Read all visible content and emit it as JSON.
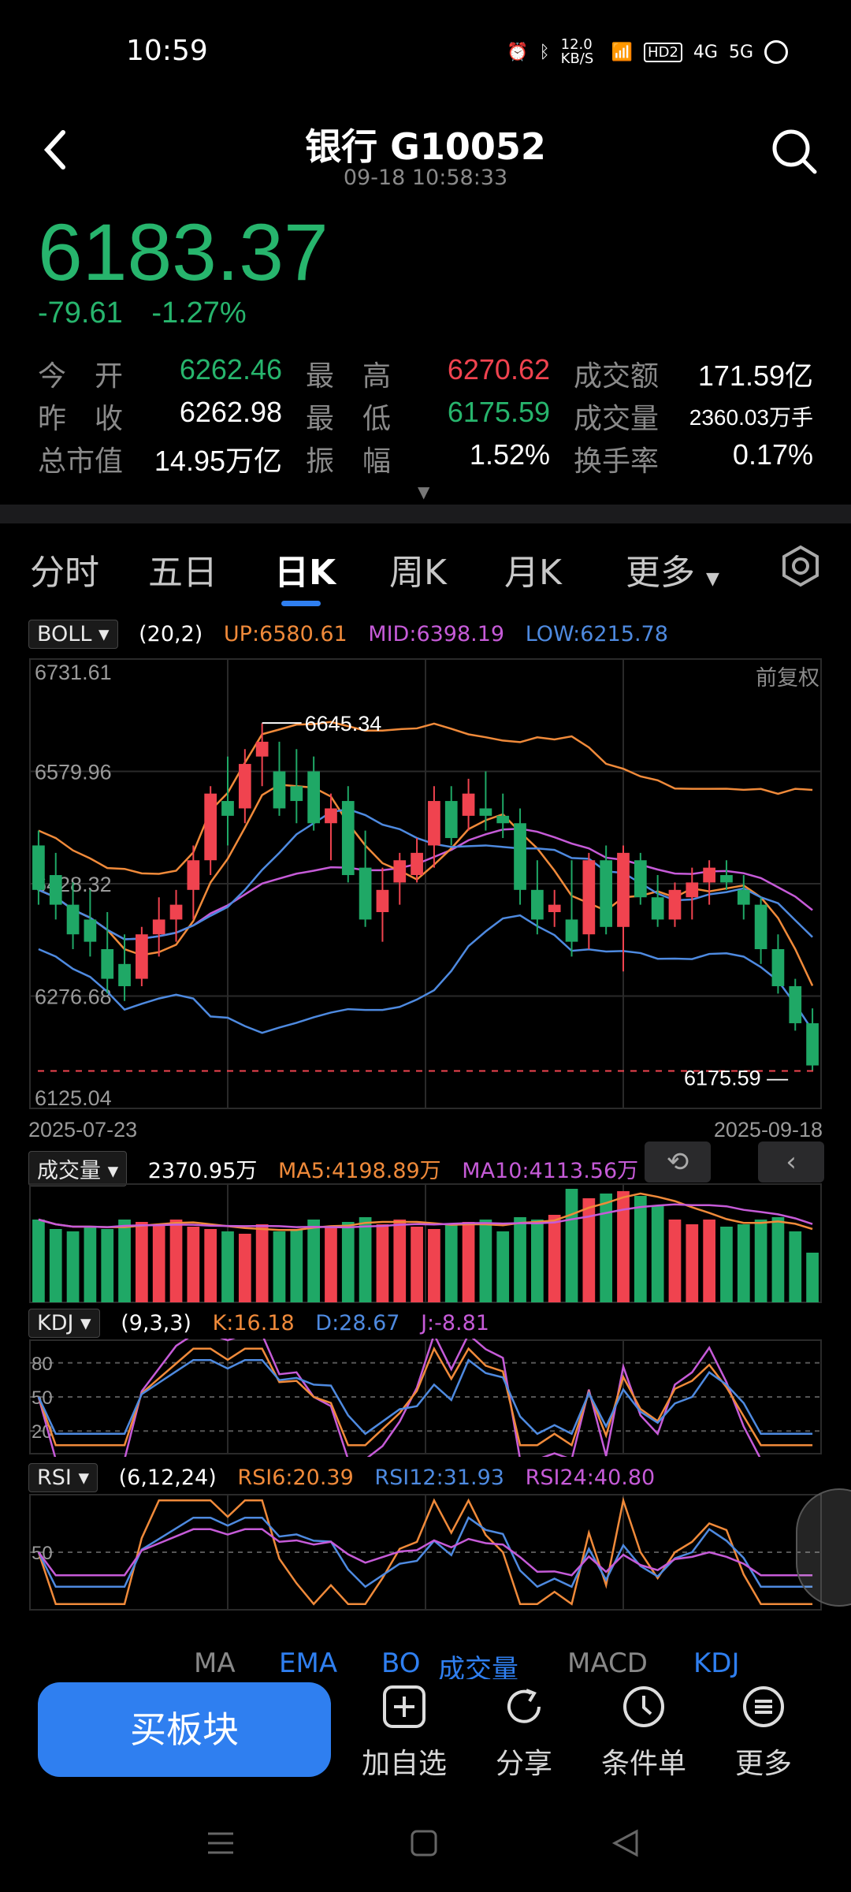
{
  "status": {
    "time": "10:59",
    "net_speed": "12.0 KB/S",
    "hd": "HD2",
    "sig1": "4G",
    "sig2": "5G"
  },
  "header": {
    "title": "银行 G10052",
    "timestamp": "09-18 10:58:33"
  },
  "quote": {
    "price": "6183.37",
    "change": "-79.61",
    "change_pct": "-1.27%"
  },
  "stats": {
    "open_label": "今　开",
    "open": "6262.46",
    "high_label": "最　高",
    "high": "6270.62",
    "turnover_label": "成交额",
    "turnover": "171.59亿",
    "prev_label": "昨　收",
    "prev": "6262.98",
    "low_label": "最　低",
    "low": "6175.59",
    "volume_label": "成交量",
    "volume": "2360.03万手",
    "mktcap_label": "总市值",
    "mktcap": "14.95万亿",
    "amp_label": "振　幅",
    "amp": "1.52%",
    "turnrate_label": "换手率",
    "turnrate": "0.17%"
  },
  "tabs": [
    "分时",
    "五日",
    "日K",
    "周K",
    "月K",
    "更多"
  ],
  "boll": {
    "name": "BOLL",
    "params": "(20,2)",
    "up": "UP:6580.61",
    "mid": "MID:6398.19",
    "low": "LOW:6215.78",
    "fq": "前复权"
  },
  "vol": {
    "name": "成交量",
    "value": "2370.95万",
    "ma5": "MA5:4198.89万",
    "ma10": "MA10:4113.56万"
  },
  "kdj": {
    "name": "KDJ",
    "params": "(9,3,3)",
    "k": "K:16.18",
    "d": "D:28.67",
    "j": "J:-8.81"
  },
  "rsi": {
    "name": "RSI",
    "params": "(6,12,24)",
    "rsi6": "RSI6:20.39",
    "rsi12": "RSI12:31.93",
    "rsi24": "RSI24:40.80"
  },
  "dates": {
    "start": "2025-07-23",
    "end": "2025-09-18"
  },
  "bottom_tabs": [
    "MA",
    "EMA",
    "BO",
    "成交量",
    "MACD",
    "KDJ"
  ],
  "actions": {
    "buy": "买板块",
    "watch": "加自选",
    "share": "分享",
    "condition": "条件单",
    "more": "更多"
  },
  "chart_data": {
    "type": "candlestick",
    "y_ticks": [
      "6731.61",
      "6579.96",
      "6428.32",
      "6276.68",
      "6125.04"
    ],
    "ylim": [
      6125.04,
      6731.61
    ],
    "annotations": {
      "max": "6645.34",
      "min": "6175.59"
    },
    "candles": [
      [
        6480,
        6500,
        6400,
        6420
      ],
      [
        6440,
        6470,
        6380,
        6400
      ],
      [
        6400,
        6430,
        6340,
        6360
      ],
      [
        6380,
        6420,
        6330,
        6350
      ],
      [
        6340,
        6390,
        6280,
        6300
      ],
      [
        6320,
        6360,
        6270,
        6290
      ],
      [
        6300,
        6370,
        6290,
        6360
      ],
      [
        6360,
        6410,
        6330,
        6380
      ],
      [
        6380,
        6420,
        6350,
        6400
      ],
      [
        6420,
        6480,
        6380,
        6460
      ],
      [
        6460,
        6560,
        6440,
        6550
      ],
      [
        6540,
        6600,
        6480,
        6520
      ],
      [
        6530,
        6610,
        6510,
        6590
      ],
      [
        6600,
        6645,
        6560,
        6620
      ],
      [
        6580,
        6620,
        6520,
        6530
      ],
      [
        6560,
        6610,
        6510,
        6540
      ],
      [
        6580,
        6600,
        6500,
        6510
      ],
      [
        6510,
        6550,
        6460,
        6530
      ],
      [
        6540,
        6560,
        6430,
        6440
      ],
      [
        6450,
        6500,
        6370,
        6380
      ],
      [
        6390,
        6450,
        6350,
        6420
      ],
      [
        6430,
        6470,
        6400,
        6460
      ],
      [
        6440,
        6490,
        6430,
        6470
      ],
      [
        6480,
        6560,
        6450,
        6540
      ],
      [
        6540,
        6560,
        6480,
        6490
      ],
      [
        6520,
        6570,
        6500,
        6550
      ],
      [
        6530,
        6580,
        6500,
        6520
      ],
      [
        6520,
        6550,
        6490,
        6510
      ],
      [
        6510,
        6530,
        6400,
        6420
      ],
      [
        6420,
        6460,
        6360,
        6380
      ],
      [
        6390,
        6420,
        6370,
        6400
      ],
      [
        6380,
        6460,
        6330,
        6350
      ],
      [
        6360,
        6470,
        6340,
        6460
      ],
      [
        6460,
        6480,
        6360,
        6370
      ],
      [
        6370,
        6480,
        6310,
        6470
      ],
      [
        6460,
        6470,
        6400,
        6410
      ],
      [
        6410,
        6440,
        6370,
        6380
      ],
      [
        6380,
        6430,
        6370,
        6420
      ],
      [
        6410,
        6450,
        6380,
        6430
      ],
      [
        6430,
        6460,
        6400,
        6450
      ],
      [
        6440,
        6460,
        6420,
        6430
      ],
      [
        6420,
        6440,
        6380,
        6400
      ],
      [
        6400,
        6410,
        6320,
        6340
      ],
      [
        6340,
        6360,
        6280,
        6290
      ],
      [
        6290,
        6300,
        6230,
        6240
      ],
      [
        6240,
        6260,
        6175,
        6183
      ]
    ],
    "volume": [
      70,
      62,
      60,
      64,
      62,
      70,
      68,
      66,
      70,
      64,
      62,
      60,
      58,
      66,
      60,
      62,
      70,
      64,
      68,
      72,
      66,
      70,
      64,
      62,
      66,
      68,
      70,
      60,
      72,
      70,
      74,
      96,
      88,
      92,
      94,
      90,
      82,
      70,
      66,
      70,
      64,
      66,
      70,
      72,
      60,
      42
    ]
  }
}
